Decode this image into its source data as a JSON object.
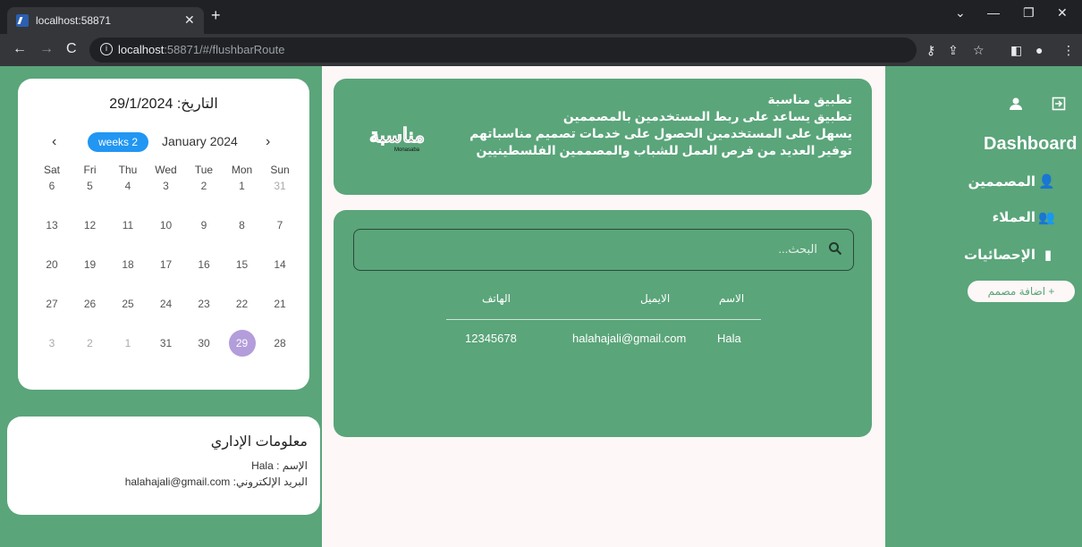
{
  "browser": {
    "tab_title": "localhost:58871",
    "url_host": "localhost",
    "url_rest": ":58871/#/flushbarRoute",
    "info_glyph": "i"
  },
  "calendar": {
    "title": "التاريخ: 29/1/2024",
    "month": "January 2024",
    "weeks_label": "weeks 2",
    "day_names": [
      "Sat",
      "Fri",
      "Thu",
      "Wed",
      "Tue",
      "Mon",
      "Sun"
    ],
    "weeks": [
      [
        "6",
        "5",
        "4",
        "3",
        "2",
        "1",
        "31"
      ],
      [
        "13",
        "12",
        "11",
        "10",
        "9",
        "8",
        "7"
      ],
      [
        "20",
        "19",
        "18",
        "17",
        "16",
        "15",
        "14"
      ],
      [
        "27",
        "26",
        "25",
        "24",
        "23",
        "22",
        "21"
      ],
      [
        "3",
        "2",
        "1",
        "31",
        "30",
        "29",
        "28"
      ]
    ],
    "selected": "29"
  },
  "banner": {
    "lines": [
      "تطبيق مناسبة",
      "تطبيق يساعد على ربط المستخدمين بالمصممين",
      "يسهل على المستخدمين الحصول على خدمات تصميم مناسباتهم",
      "توفير العديد من فرص العمل للشباب والمصممين الفلسطينيين"
    ],
    "logo_text": "مناسبة",
    "logo_sub": "Monasaba"
  },
  "search": {
    "placeholder": "البحث..."
  },
  "table": {
    "headers": {
      "name": "الاسم",
      "email": "الايميل",
      "phone": "الهاتف"
    },
    "rows": [
      {
        "name": "Hala",
        "email": "halahajali@gmail.com",
        "phone": "12345678"
      }
    ]
  },
  "admin": {
    "title": "معلومات الإداري",
    "name_line": "الإسم : Hala",
    "email_line": "البريد الإلكتروني: halahajali@gmail.com"
  },
  "sidebar": {
    "title": "Dashboard",
    "items": [
      {
        "label": "المصممين",
        "icon": "person-icon"
      },
      {
        "label": "العملاء",
        "icon": "people-icon"
      },
      {
        "label": "الإحصائيات",
        "icon": "chart-icon"
      }
    ],
    "add_button": "اضافة مصمم"
  },
  "colors": {
    "brand_green": "#5aa57a",
    "accent_blue": "#2196f3",
    "selected_day": "#b39ddb"
  }
}
